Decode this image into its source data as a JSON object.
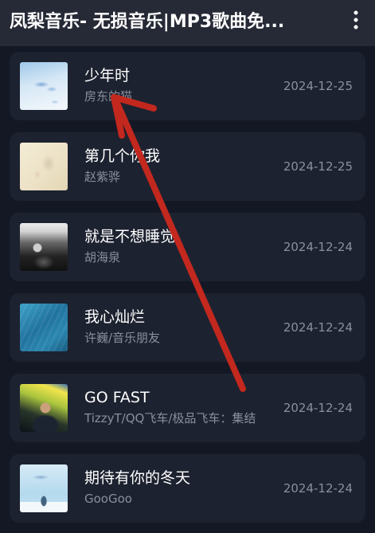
{
  "header": {
    "title": "凤梨音乐- 无损音乐|MP3歌曲免...",
    "menu_icon": "more-vertical-icon"
  },
  "songs": [
    {
      "title": "少年时",
      "artist": "房东的猫",
      "date": "2024-12-25"
    },
    {
      "title": "第几个你我",
      "artist": "赵紫骅",
      "date": "2024-12-25"
    },
    {
      "title": "就是不想睡觉",
      "artist": "胡海泉",
      "date": "2024-12-24"
    },
    {
      "title": "我心灿烂",
      "artist": "许巍/音乐朋友",
      "date": "2024-12-24"
    },
    {
      "title": "GO FAST",
      "artist": "TizzyT/QQ飞车/极品飞车：集结",
      "date": "2024-12-24"
    },
    {
      "title": "期待有你的冬天",
      "artist": "GooGoo",
      "date": "2024-12-24"
    }
  ],
  "annotation": {
    "icon": "red-arrow-icon"
  },
  "theme": {
    "page_bg": "#141825",
    "header_bg": "#262a36",
    "card_bg": "#1d2230",
    "primary_text": "#ffffff",
    "secondary_text": "#8a8f9f",
    "annotation_red": "#c3281e"
  }
}
